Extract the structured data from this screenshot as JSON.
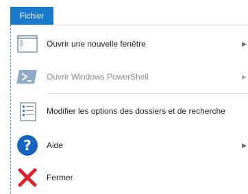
{
  "tab": {
    "label": "Fichier"
  },
  "menu": {
    "items": [
      {
        "label": "Ouvrir une nouvelle fenêtre",
        "icon": "window-icon",
        "has_submenu": true,
        "enabled": true
      },
      {
        "label": "Ouvrir Windows PowerShell",
        "icon": "powershell-icon",
        "has_submenu": true,
        "enabled": false
      },
      {
        "label": "Modifier les options des dossiers et de recherche",
        "icon": "folder-options-icon",
        "has_submenu": false,
        "enabled": true
      },
      {
        "label": "Aide",
        "icon": "help-icon",
        "has_submenu": true,
        "enabled": true
      },
      {
        "label": "Fermer",
        "icon": "close-icon",
        "has_submenu": false,
        "enabled": true
      }
    ],
    "submenu_arrow": "▶"
  },
  "colors": {
    "tab_bg": "#1979ca",
    "disabled_text": "#8a8a8a",
    "help_blue": "#1565c0",
    "close_red": "#e0202a"
  }
}
